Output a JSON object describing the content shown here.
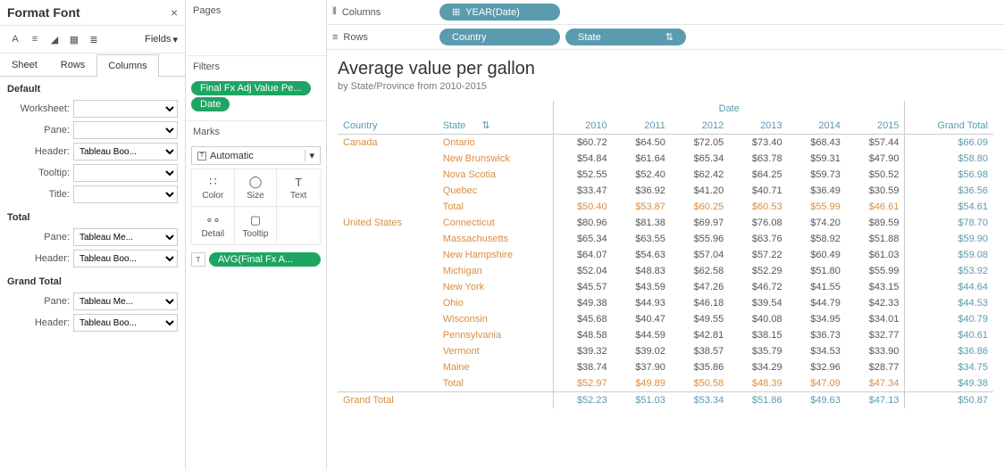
{
  "format_panel": {
    "title": "Format Font",
    "fields_label": "Fields",
    "tabs": [
      "Sheet",
      "Rows",
      "Columns"
    ],
    "active_tab": 2,
    "sections": {
      "default": {
        "label": "Default",
        "rows": [
          {
            "label": "Worksheet:",
            "value": ""
          },
          {
            "label": "Pane:",
            "value": ""
          },
          {
            "label": "Header:",
            "value": "Tableau Boo..."
          },
          {
            "label": "Tooltip:",
            "value": ""
          },
          {
            "label": "Title:",
            "value": ""
          }
        ]
      },
      "total": {
        "label": "Total",
        "rows": [
          {
            "label": "Pane:",
            "value": "Tableau Me..."
          },
          {
            "label": "Header:",
            "value": "Tableau Boo..."
          }
        ]
      },
      "grand_total": {
        "label": "Grand Total",
        "rows": [
          {
            "label": "Pane:",
            "value": "Tableau Me..."
          },
          {
            "label": "Header:",
            "value": "Tableau Boo..."
          }
        ]
      }
    }
  },
  "middle": {
    "pages_label": "Pages",
    "filters_label": "Filters",
    "filter_pills": [
      "Final Fx Adj Value Pe...",
      "Date"
    ],
    "marks_label": "Marks",
    "marks_type": "Automatic",
    "marks_cells": [
      "Color",
      "Size",
      "Text",
      "Detail",
      "Tooltip"
    ],
    "avg_pill": "AVG(Final Fx A..."
  },
  "shelves": {
    "columns_label": "Columns",
    "rows_label": "Rows",
    "columns_pills": [
      "YEAR(Date)"
    ],
    "rows_pills": [
      "Country",
      "State"
    ]
  },
  "viz": {
    "title": "Average value per gallon",
    "subtitle": "by State/Province from 2010-2015",
    "date_header": "Date",
    "headers": {
      "country": "Country",
      "state": "State",
      "grand_total": "Grand Total"
    },
    "years": [
      "2010",
      "2011",
      "2012",
      "2013",
      "2014",
      "2015"
    ],
    "data": [
      {
        "country": "Canada",
        "rows": [
          {
            "state": "Ontario",
            "vals": [
              "$60.72",
              "$64.50",
              "$72.05",
              "$73.40",
              "$68.43",
              "$57.44"
            ],
            "gt": "$66.09"
          },
          {
            "state": "New Brunswick",
            "vals": [
              "$54.84",
              "$61.64",
              "$65.34",
              "$63.78",
              "$59.31",
              "$47.90"
            ],
            "gt": "$58.80"
          },
          {
            "state": "Nova Scotia",
            "vals": [
              "$52.55",
              "$52.40",
              "$62.42",
              "$64.25",
              "$59.73",
              "$50.52"
            ],
            "gt": "$56.98"
          },
          {
            "state": "Quebec",
            "vals": [
              "$33.47",
              "$36.92",
              "$41.20",
              "$40.71",
              "$36.49",
              "$30.59"
            ],
            "gt": "$36.56"
          },
          {
            "state": "Total",
            "vals": [
              "$50.40",
              "$53.87",
              "$60.25",
              "$60.53",
              "$55.99",
              "$46.61"
            ],
            "gt": "$54.61",
            "total": true
          }
        ]
      },
      {
        "country": "United States",
        "rows": [
          {
            "state": "Connecticut",
            "vals": [
              "$80.96",
              "$81.38",
              "$69.97",
              "$76.08",
              "$74.20",
              "$89.59"
            ],
            "gt": "$78.70"
          },
          {
            "state": "Massachusetts",
            "vals": [
              "$65.34",
              "$63.55",
              "$55.96",
              "$63.76",
              "$58.92",
              "$51.88"
            ],
            "gt": "$59.90"
          },
          {
            "state": "New Hampshire",
            "vals": [
              "$64.07",
              "$54.63",
              "$57.04",
              "$57.22",
              "$60.49",
              "$61.03"
            ],
            "gt": "$59.08"
          },
          {
            "state": "Michigan",
            "vals": [
              "$52.04",
              "$48.83",
              "$62.58",
              "$52.29",
              "$51.80",
              "$55.99"
            ],
            "gt": "$53.92"
          },
          {
            "state": "New York",
            "vals": [
              "$45.57",
              "$43.59",
              "$47.26",
              "$46.72",
              "$41.55",
              "$43.15"
            ],
            "gt": "$44.64"
          },
          {
            "state": "Ohio",
            "vals": [
              "$49.38",
              "$44.93",
              "$46.18",
              "$39.54",
              "$44.79",
              "$42.33"
            ],
            "gt": "$44.53"
          },
          {
            "state": "Wisconsin",
            "vals": [
              "$45.68",
              "$40.47",
              "$49.55",
              "$40.08",
              "$34.95",
              "$34.01"
            ],
            "gt": "$40.79"
          },
          {
            "state": "Pennsylvania",
            "vals": [
              "$48.58",
              "$44.59",
              "$42.81",
              "$38.15",
              "$36.73",
              "$32.77"
            ],
            "gt": "$40.61"
          },
          {
            "state": "Vermont",
            "vals": [
              "$39.32",
              "$39.02",
              "$38.57",
              "$35.79",
              "$34.53",
              "$33.90"
            ],
            "gt": "$36.86"
          },
          {
            "state": "Maine",
            "vals": [
              "$38.74",
              "$37.90",
              "$35.86",
              "$34.29",
              "$32.96",
              "$28.77"
            ],
            "gt": "$34.75"
          },
          {
            "state": "Total",
            "vals": [
              "$52.97",
              "$49.89",
              "$50.58",
              "$48.39",
              "$47.09",
              "$47.34"
            ],
            "gt": "$49.38",
            "total": true
          }
        ]
      }
    ],
    "grand_total_row": {
      "label": "Grand Total",
      "vals": [
        "$52.23",
        "$51.03",
        "$53.34",
        "$51.86",
        "$49.63",
        "$47.13"
      ],
      "gt": "$50.87"
    }
  }
}
